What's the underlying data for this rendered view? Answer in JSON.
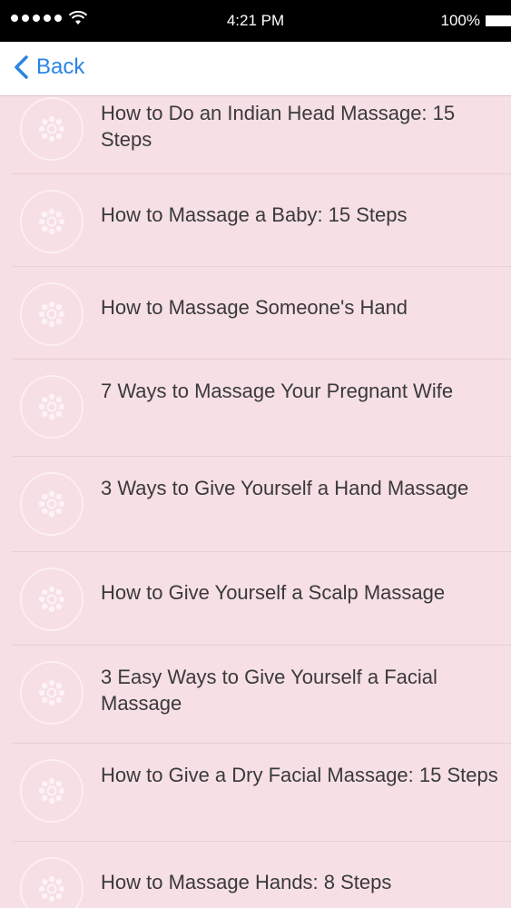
{
  "status_bar": {
    "time": "4:21 PM",
    "battery": "100%"
  },
  "nav": {
    "back_label": "Back"
  },
  "items": [
    {
      "title": "How to Do an Indian Head Massage: 15 Steps",
      "lines": 2
    },
    {
      "title": "How to Massage a Baby: 15 Steps",
      "lines": 1
    },
    {
      "title": "How to Massage Someone's Hand",
      "lines": 1
    },
    {
      "title": "7 Ways to Massage Your Pregnant Wife",
      "lines": 2
    },
    {
      "title": "3 Ways to Give Yourself a Hand Massage",
      "lines": 2
    },
    {
      "title": "How to Give Yourself a Scalp Massage",
      "lines": 1
    },
    {
      "title": "3 Easy Ways to Give Yourself a Facial Massage",
      "lines": 2
    },
    {
      "title": "How to Give a Dry Facial Massage: 15 Steps",
      "lines": 2
    },
    {
      "title": "How to Massage Hands: 8 Steps",
      "lines": 1
    }
  ],
  "colors": {
    "background": "#f6dfe5",
    "accent": "#2a84e6"
  }
}
